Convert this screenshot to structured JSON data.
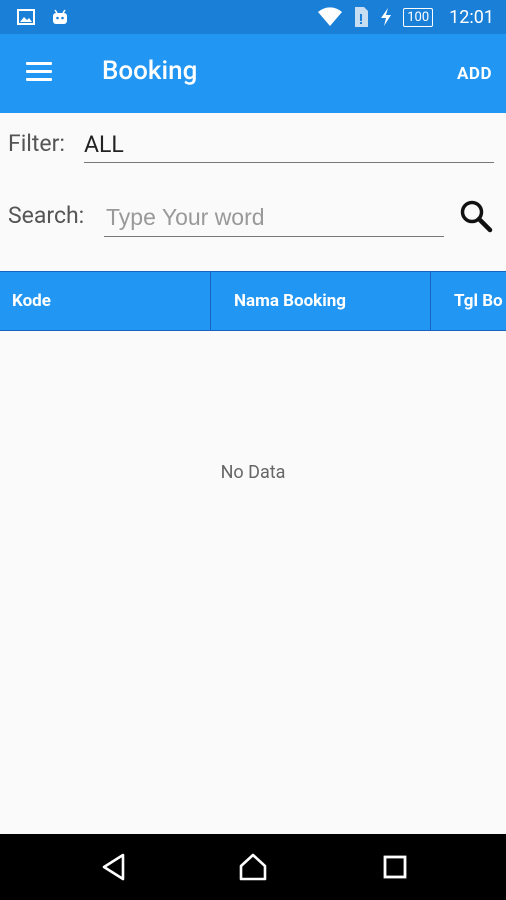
{
  "status_bar": {
    "time": "12:01",
    "battery": "100",
    "icons": [
      "image-icon",
      "android-icon",
      "wifi-icon",
      "sim-icon",
      "charging-icon",
      "battery-icon"
    ]
  },
  "app_bar": {
    "title": "Booking",
    "add_label": "ADD",
    "menu_icon": "menu-icon"
  },
  "filter": {
    "label": "Filter:",
    "value": "ALL"
  },
  "search": {
    "label": "Search:",
    "placeholder": "Type Your word",
    "value": "",
    "icon": "search-icon"
  },
  "table": {
    "columns": [
      "Kode",
      "Nama Booking",
      "Tgl Bo"
    ],
    "rows": [],
    "empty_text": "No Data"
  },
  "nav_bar": {
    "icons": [
      "back-icon",
      "home-icon",
      "recents-icon"
    ]
  },
  "colors": {
    "primary": "#2196f3",
    "status_bar": "#1a7fd6",
    "background": "#fafafa"
  }
}
